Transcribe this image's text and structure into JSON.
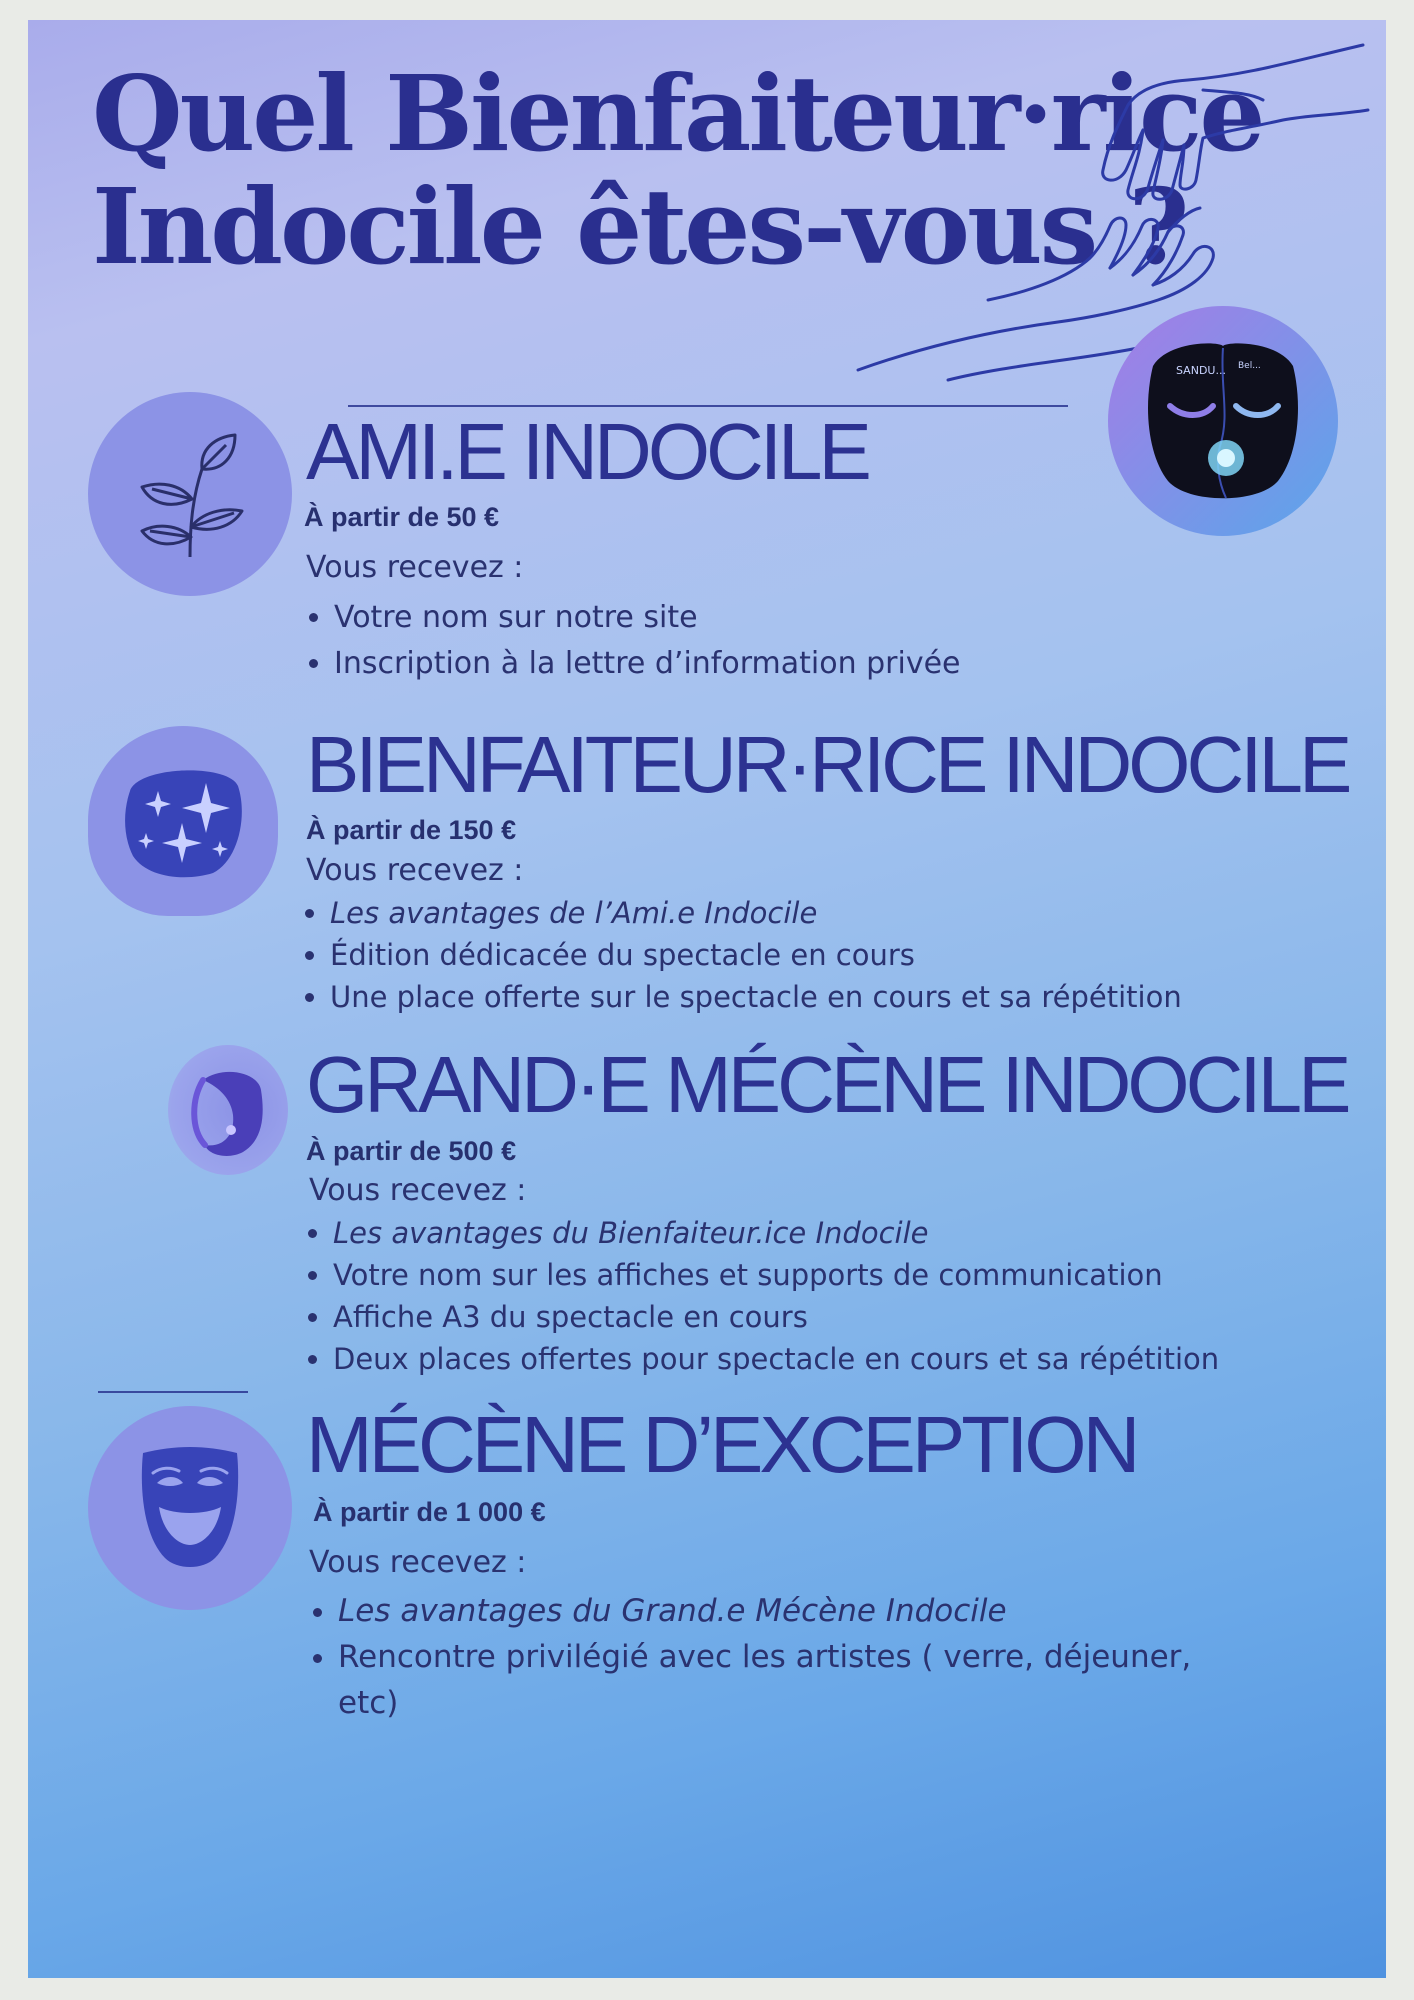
{
  "title": {
    "line1": "Quel Bienfaiteur·rice",
    "line2": "Indocile êtes-vous ?"
  },
  "mask_logo": {
    "label_left": "SANDU...",
    "label_right": "Bel...",
    "icon": "two-face-mask-icon"
  },
  "tiers": [
    {
      "name": "AMI.E INDOCILE",
      "price": "À partir de 50 €",
      "intro": "Vous recevez :",
      "icon": "leaf-sprig-icon",
      "benefits": [
        "Votre nom sur notre site",
        "Inscription à la lettre d’information privée"
      ]
    },
    {
      "name": "BIENFAITEUR·RICE INDOCILE",
      "price": "À partir de 150 €",
      "intro": "Vous recevez :",
      "icon": "sparkles-icon",
      "benefits": [
        "Les avantages de l’Ami.e Indocile",
        "Édition dédicacée du spectacle en cours",
        "Une place offerte sur le spectacle en cours et sa répétition"
      ]
    },
    {
      "name": "GRAND·E MÉCÈNE INDOCILE",
      "price": "À partir de 500 €",
      "intro": "Vous recevez :",
      "icon": "moon-icon",
      "benefits": [
        "Les avantages du Bienfaiteur.ice Indocile",
        "Votre nom sur les affiches et supports de communication",
        "Affiche A3 du spectacle en cours",
        "Deux places offertes pour spectacle en cours et sa répétition"
      ]
    },
    {
      "name": "MÉCÈNE D’EXCEPTION",
      "price": "À partir de 1 000 €",
      "intro": "Vous recevez :",
      "icon": "theater-mask-icon",
      "benefits": [
        "Les avantages du Grand.e Mécène Indocile",
        "Rencontre privilégié avec les artistes  ( verre, déjeuner, etc)"
      ]
    }
  ],
  "colors": {
    "title": "#2a2f8f",
    "text": "#2a3270",
    "circle": "#8c93e6",
    "background_top": "#a9aceb",
    "background_bottom": "#4f92e0"
  }
}
